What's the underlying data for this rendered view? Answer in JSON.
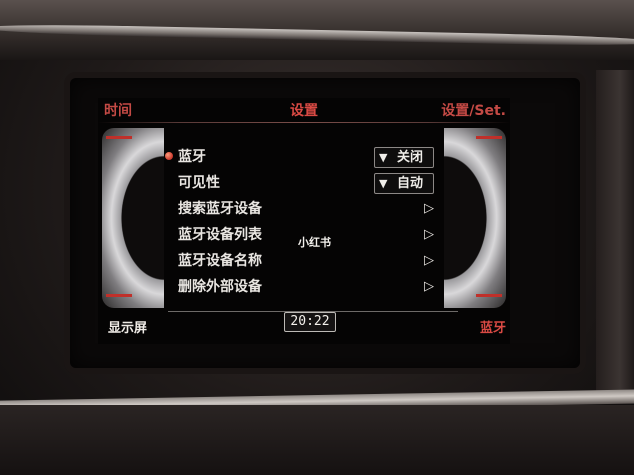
{
  "header": {
    "left": "时间",
    "title": "设置",
    "right": "设置/Set."
  },
  "menu": {
    "items": [
      {
        "label": "蓝牙",
        "control": "dropdown",
        "value": "关闭",
        "selected": true
      },
      {
        "label": "可见性",
        "control": "dropdown",
        "value": "自动",
        "selected": false
      },
      {
        "label": "搜索蓝牙设备",
        "control": "arrow",
        "arrow": "▷"
      },
      {
        "label": "蓝牙设备列表",
        "control": "arrow",
        "arrow": "▷"
      },
      {
        "label": "蓝牙设备名称",
        "control": "arrow",
        "arrow": "▷"
      },
      {
        "label": "删除外部设备",
        "control": "arrow",
        "arrow": "▷"
      }
    ]
  },
  "dropdown_icon": "▼",
  "watermark": "小红书",
  "footer": {
    "left": "显示屏",
    "clock": "20:22",
    "right": "蓝牙"
  },
  "colors": {
    "accent_red": "#d94a44",
    "text": "#e9e6e2",
    "background": "#050404"
  }
}
